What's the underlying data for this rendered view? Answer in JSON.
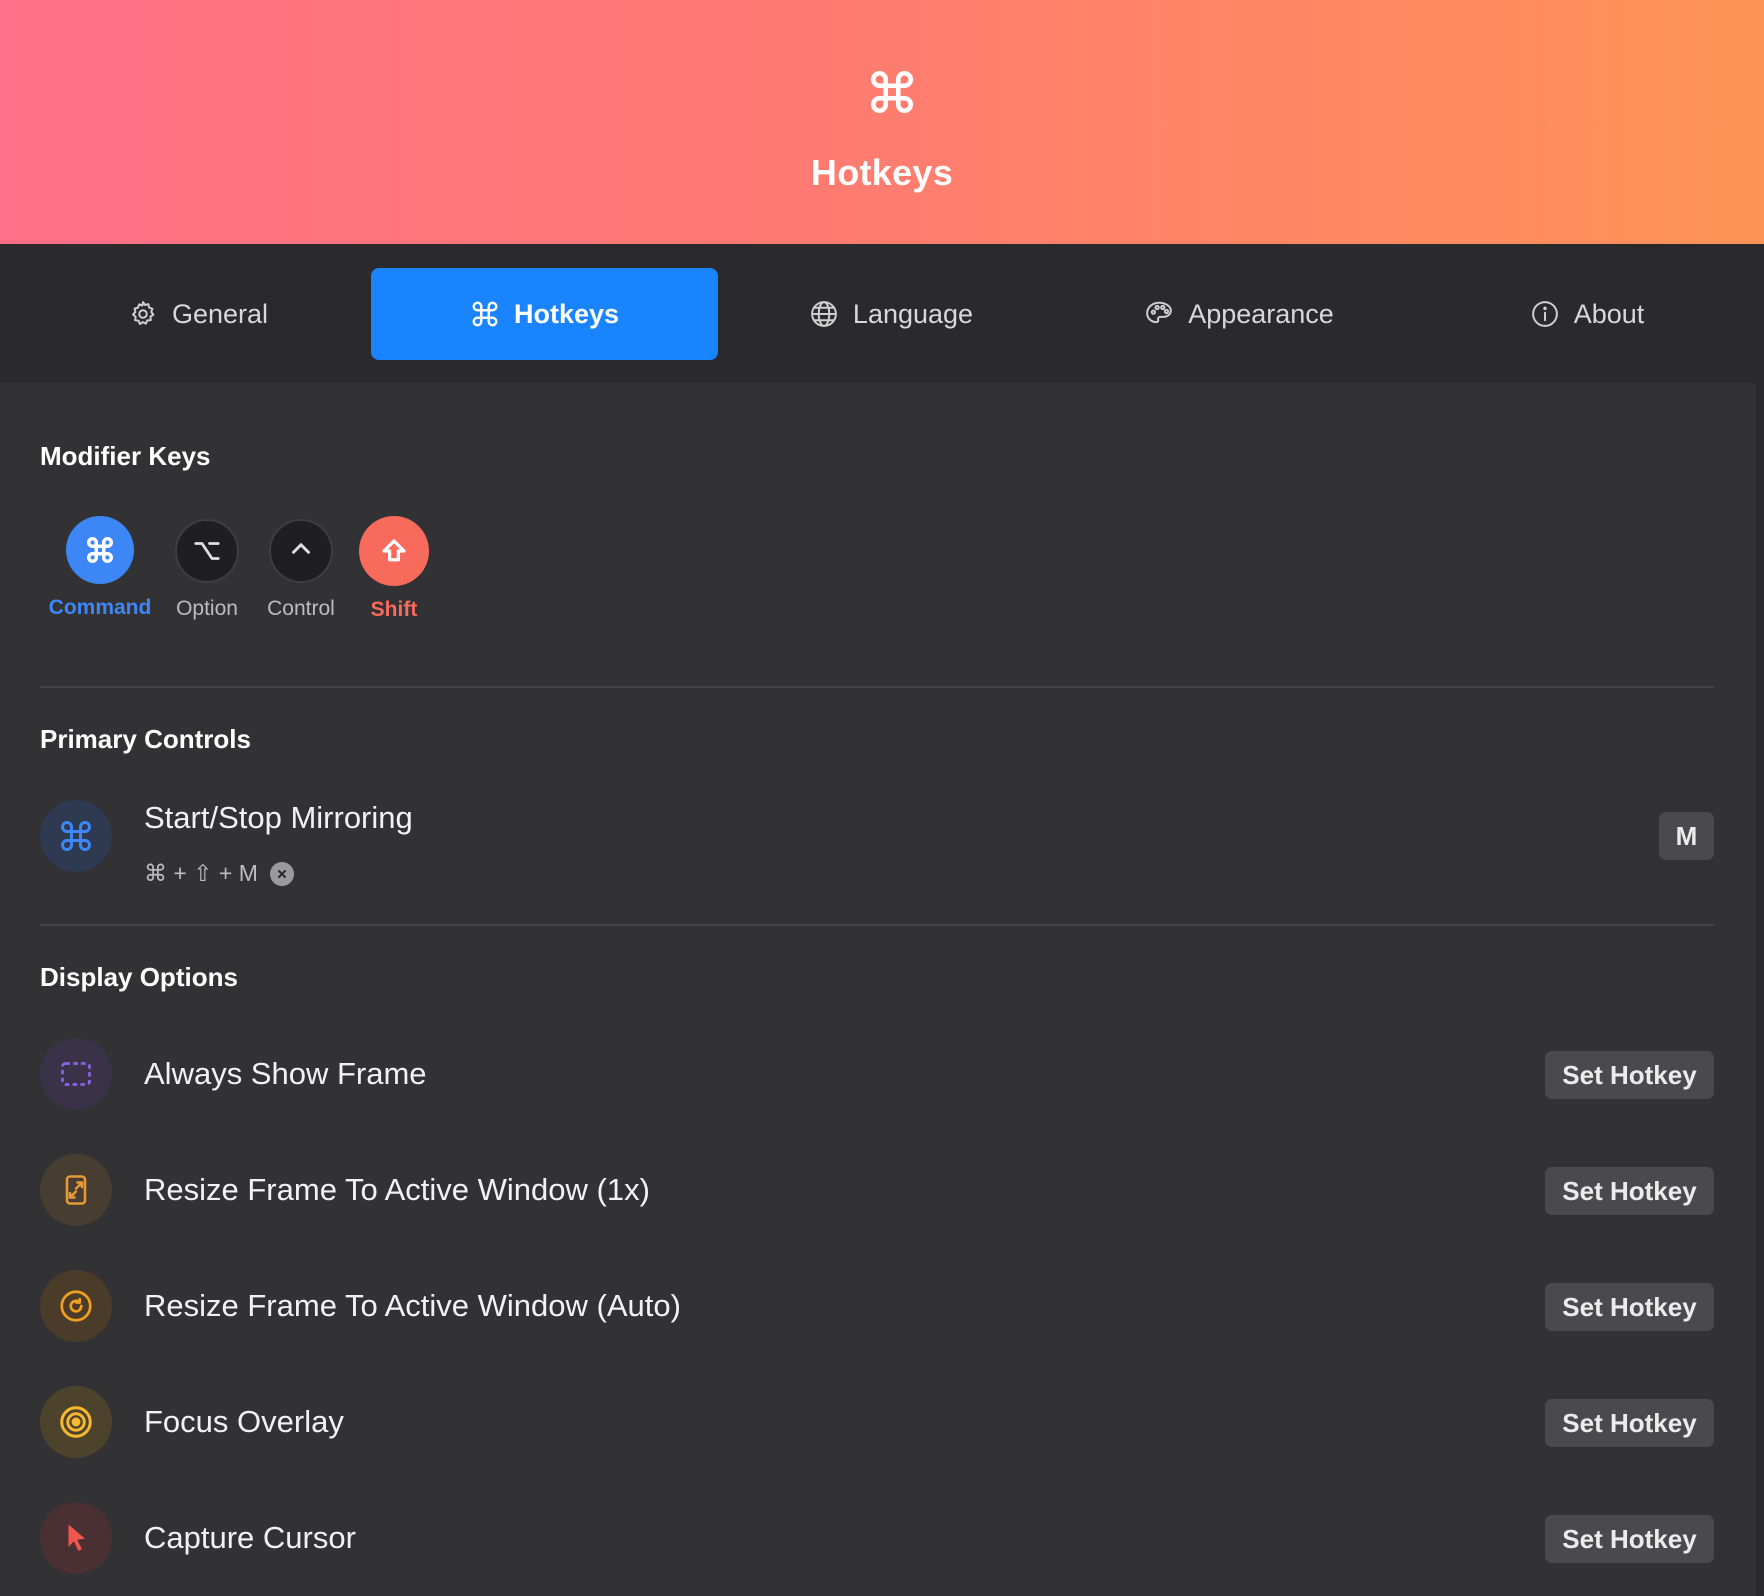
{
  "header": {
    "title": "Hotkeys",
    "icon": "command-icon"
  },
  "tabs": [
    {
      "label": "General",
      "icon": "gear-icon",
      "active": false
    },
    {
      "label": "Hotkeys",
      "icon": "command-icon",
      "active": true
    },
    {
      "label": "Language",
      "icon": "globe-icon",
      "active": false
    },
    {
      "label": "Appearance",
      "icon": "palette-icon",
      "active": false
    },
    {
      "label": "About",
      "icon": "info-icon",
      "active": false
    }
  ],
  "modifier_keys": {
    "title": "Modifier Keys",
    "keys": [
      {
        "label": "Command",
        "symbol": "⌘",
        "selected": true,
        "color": "#3d86f5"
      },
      {
        "label": "Option",
        "symbol": "⌥",
        "selected": false,
        "color": "#1f1f21"
      },
      {
        "label": "Control",
        "symbol": "^",
        "selected": false,
        "color": "#1f1f21"
      },
      {
        "label": "Shift",
        "symbol": "⇧",
        "selected": true,
        "color": "#f76a5c"
      }
    ]
  },
  "primary_controls": {
    "title": "Primary Controls",
    "items": [
      {
        "title": "Start/Stop Mirroring",
        "shortcut": "⌘ + ⇧ + M",
        "key": "M",
        "icon": "command-icon"
      }
    ]
  },
  "display_options": {
    "title": "Display Options",
    "button_label": "Set Hotkey",
    "items": [
      {
        "title": "Always Show Frame",
        "icon": "dashed-frame-icon",
        "color": "#8a63e6"
      },
      {
        "title": "Resize Frame To Active Window (1x)",
        "icon": "resize-window-icon",
        "color": "#e59a35"
      },
      {
        "title": "Resize Frame To Active Window (Auto)",
        "icon": "auto-refresh-icon",
        "color": "#f0a020"
      },
      {
        "title": "Focus Overlay",
        "icon": "target-icon",
        "color": "#f5b82e"
      },
      {
        "title": "Capture Cursor",
        "icon": "cursor-icon",
        "color": "#f2554e"
      }
    ]
  }
}
